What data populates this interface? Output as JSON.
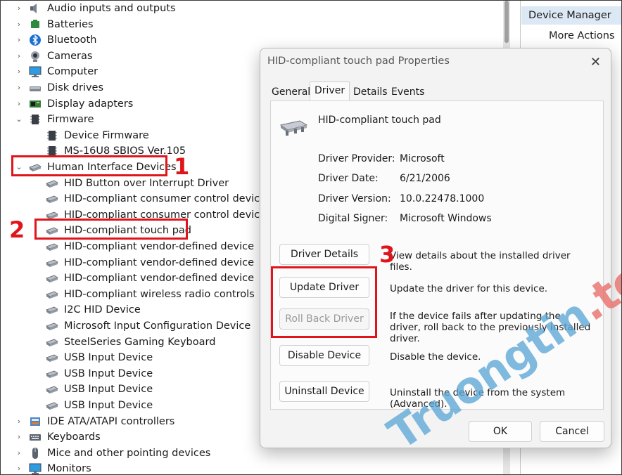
{
  "tree": {
    "items": [
      {
        "label": "Audio inputs and outputs",
        "level": 0,
        "chev": "›",
        "icon": "speaker-icon"
      },
      {
        "label": "Batteries",
        "level": 0,
        "chev": "›",
        "icon": "battery-icon"
      },
      {
        "label": "Bluetooth",
        "level": 0,
        "chev": "›",
        "icon": "bluetooth-icon"
      },
      {
        "label": "Cameras",
        "level": 0,
        "chev": "›",
        "icon": "camera-icon"
      },
      {
        "label": "Computer",
        "level": 0,
        "chev": "›",
        "icon": "monitor-icon"
      },
      {
        "label": "Disk drives",
        "level": 0,
        "chev": "›",
        "icon": "disk-icon"
      },
      {
        "label": "Display adapters",
        "level": 0,
        "chev": "›",
        "icon": "display-adapter-icon"
      },
      {
        "label": "Firmware",
        "level": 0,
        "chev": "⌄",
        "icon": "chip-icon"
      },
      {
        "label": "Device Firmware",
        "level": 1,
        "chev": "",
        "icon": "chip-icon"
      },
      {
        "label": "MS-16U8 SBIOS Ver.105",
        "level": 1,
        "chev": "",
        "icon": "chip-icon"
      },
      {
        "label": "Human Interface Devices",
        "level": 0,
        "chev": "⌄",
        "icon": "hid-icon"
      },
      {
        "label": "HID Button over Interrupt Driver",
        "level": 1,
        "chev": "",
        "icon": "hid-icon"
      },
      {
        "label": "HID-compliant consumer control device",
        "level": 1,
        "chev": "",
        "icon": "hid-icon"
      },
      {
        "label": "HID-compliant consumer control device",
        "level": 1,
        "chev": "",
        "icon": "hid-icon"
      },
      {
        "label": "HID-compliant touch pad",
        "level": 1,
        "chev": "",
        "icon": "hid-icon"
      },
      {
        "label": "HID-compliant vendor-defined device",
        "level": 1,
        "chev": "",
        "icon": "hid-icon"
      },
      {
        "label": "HID-compliant vendor-defined device",
        "level": 1,
        "chev": "",
        "icon": "hid-icon"
      },
      {
        "label": "HID-compliant vendor-defined device",
        "level": 1,
        "chev": "",
        "icon": "hid-icon"
      },
      {
        "label": "HID-compliant wireless radio controls",
        "level": 1,
        "chev": "",
        "icon": "hid-icon"
      },
      {
        "label": "I2C HID Device",
        "level": 1,
        "chev": "",
        "icon": "hid-icon"
      },
      {
        "label": "Microsoft Input Configuration Device",
        "level": 1,
        "chev": "",
        "icon": "hid-icon"
      },
      {
        "label": "SteelSeries Gaming Keyboard",
        "level": 1,
        "chev": "",
        "icon": "hid-icon"
      },
      {
        "label": "USB Input Device",
        "level": 1,
        "chev": "",
        "icon": "hid-icon"
      },
      {
        "label": "USB Input Device",
        "level": 1,
        "chev": "",
        "icon": "hid-icon"
      },
      {
        "label": "USB Input Device",
        "level": 1,
        "chev": "",
        "icon": "hid-icon"
      },
      {
        "label": "USB Input Device",
        "level": 1,
        "chev": "",
        "icon": "hid-icon"
      },
      {
        "label": "IDE ATA/ATAPI controllers",
        "level": 0,
        "chev": "›",
        "icon": "ide-icon"
      },
      {
        "label": "Keyboards",
        "level": 0,
        "chev": "›",
        "icon": "keyboard-icon"
      },
      {
        "label": "Mice and other pointing devices",
        "level": 0,
        "chev": "›",
        "icon": "mouse-icon"
      },
      {
        "label": "Monitors",
        "level": 0,
        "chev": "›",
        "icon": "monitor-icon"
      }
    ]
  },
  "actions": {
    "header": "Device Manager",
    "more_actions": "More Actions"
  },
  "dialog": {
    "title": "HID-compliant touch pad Properties",
    "close_glyph": "✕",
    "tabs": [
      "General",
      "Driver",
      "Details",
      "Events"
    ],
    "active_tab": "Driver",
    "device_name": "HID-compliant touch pad",
    "properties": [
      {
        "label": "Driver Provider:",
        "value": "Microsoft"
      },
      {
        "label": "Driver Date:",
        "value": "6/21/2006"
      },
      {
        "label": "Driver Version:",
        "value": "10.0.22478.1000"
      },
      {
        "label": "Digital Signer:",
        "value": "Microsoft Windows"
      }
    ],
    "buttons": [
      {
        "label": "Driver Details",
        "desc": "View details about the installed driver files.",
        "enabled": true
      },
      {
        "label": "Update Driver",
        "desc": "Update the driver for this device.",
        "enabled": true
      },
      {
        "label": "Roll Back Driver",
        "desc": "If the device fails after updating the driver, roll back to the previously installed driver.",
        "enabled": false
      },
      {
        "label": "Disable Device",
        "desc": "Disable the device.",
        "enabled": true
      },
      {
        "label": "Uninstall Device",
        "desc": "Uninstall the device from the system (Advanced).",
        "enabled": true
      }
    ],
    "ok_label": "OK",
    "cancel_label": "Cancel"
  },
  "annotations": {
    "step1": "1",
    "step2": "2",
    "step3": "3",
    "color": "#e0151b"
  },
  "watermark": {
    "text": "Truongtin",
    "dot": ".",
    "tld": "top"
  }
}
